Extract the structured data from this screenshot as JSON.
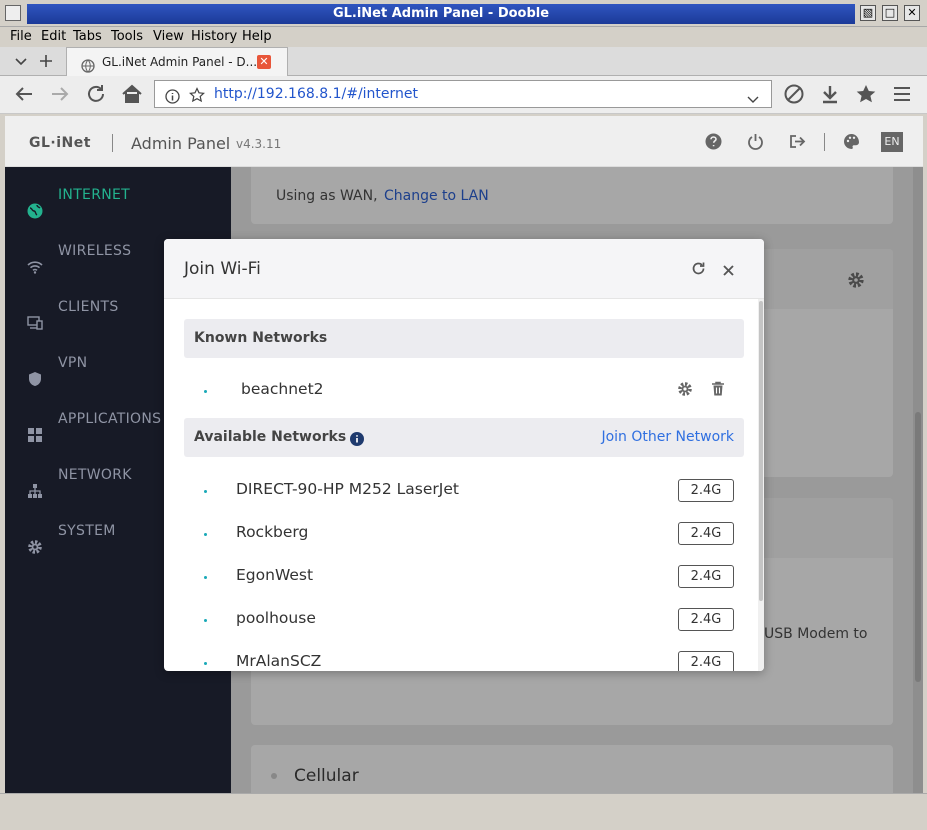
{
  "window": {
    "title": "GL.iNet Admin Panel - Dooble"
  },
  "menu": [
    "File",
    "Edit",
    "Tabs",
    "Tools",
    "View",
    "History",
    "Help"
  ],
  "tab": {
    "title": "GL.iNet Admin Panel - D...",
    "close": "✕"
  },
  "nav": {
    "url_prefix": "http://192.168.8.1/",
    "url_rest": "#/internet"
  },
  "header": {
    "logo": "GL·iNet",
    "title": "Admin Panel",
    "version": "v4.3.11",
    "language": "EN"
  },
  "sidebar": {
    "items": [
      {
        "label": "INTERNET",
        "icon": "globe-icon",
        "active": true
      },
      {
        "label": "WIRELESS",
        "icon": "wifi-icon"
      },
      {
        "label": "CLIENTS",
        "icon": "devices-icon"
      },
      {
        "label": "VPN",
        "icon": "shield-icon"
      },
      {
        "label": "APPLICATIONS",
        "icon": "apps-icon"
      },
      {
        "label": "NETWORK",
        "icon": "network-icon"
      },
      {
        "label": "SYSTEM",
        "icon": "gear-icon"
      }
    ]
  },
  "content": {
    "wan_text": "Using as WAN,",
    "change_link": "Change to LAN",
    "usb_text": "USB Modem to",
    "cellular_title": "Cellular"
  },
  "modal": {
    "title": "Join Wi-Fi",
    "known_title": "Known Networks",
    "known": [
      {
        "ssid": "beachnet2"
      }
    ],
    "available_title": "Available Networks",
    "join_other": "Join Other Network",
    "available": [
      {
        "ssid": "DIRECT-90-HP M252 LaserJet",
        "band": "2.4G"
      },
      {
        "ssid": "Rockberg",
        "band": "2.4G"
      },
      {
        "ssid": "EgonWest",
        "band": "2.4G"
      },
      {
        "ssid": "poolhouse",
        "band": "2.4G"
      },
      {
        "ssid": "MrAlanSCZ",
        "band": "2.4G"
      }
    ]
  },
  "colors": {
    "accent": "#23b28e",
    "link": "#2f6fe0",
    "sidebar_bg": "#171a26",
    "titlebar": "#1c3a98"
  }
}
